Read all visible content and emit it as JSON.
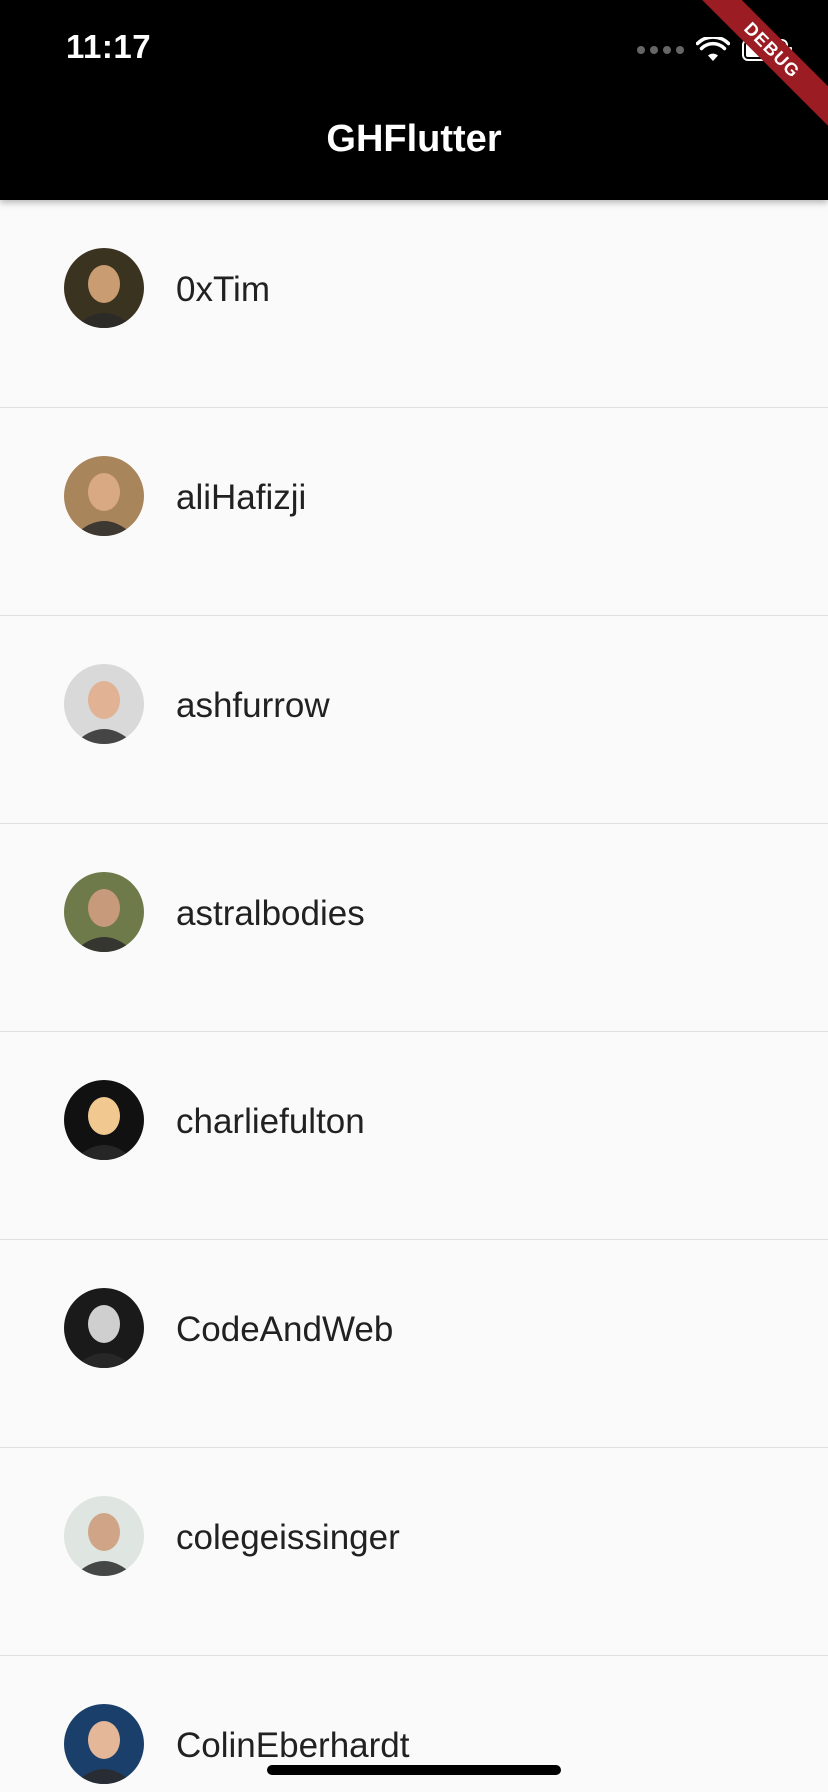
{
  "status_bar": {
    "time": "11:17"
  },
  "app_bar": {
    "title": "GHFlutter"
  },
  "debug_banner": {
    "label": "DEBUG",
    "color": "#9b1c22"
  },
  "members": [
    {
      "login": "0xTim",
      "avatar_bg": "#3a3320",
      "avatar_face": "#c99c72"
    },
    {
      "login": "aliHafizji",
      "avatar_bg": "#a8855b",
      "avatar_face": "#d9a983"
    },
    {
      "login": "ashfurrow",
      "avatar_bg": "#d9d9d9",
      "avatar_face": "#e1b294"
    },
    {
      "login": "astralbodies",
      "avatar_bg": "#6f7a4a",
      "avatar_face": "#c79a7b"
    },
    {
      "login": "charliefulton",
      "avatar_bg": "#111111",
      "avatar_face": "#f0c890"
    },
    {
      "login": "CodeAndWeb",
      "avatar_bg": "#1a1a1a",
      "avatar_face": "#cfcfcf"
    },
    {
      "login": "colegeissinger",
      "avatar_bg": "#dfe5e0",
      "avatar_face": "#d0a487"
    },
    {
      "login": "ColinEberhardt",
      "avatar_bg": "#1b3f6b",
      "avatar_face": "#e3b797"
    }
  ]
}
